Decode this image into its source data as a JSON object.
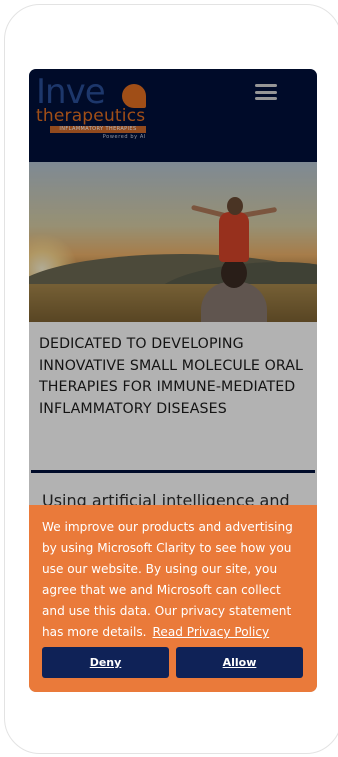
{
  "header": {
    "logo": {
      "word": "Inve",
      "sub": "therapeutics",
      "bar": "INFLAMMATORY THERAPIES",
      "powered": "Powered by AI",
      "colors": {
        "primary": "#2a4f9a",
        "accent": "#e67022"
      }
    },
    "menu_icon": "hamburger-menu-icon",
    "background": "#00103b"
  },
  "hero": {
    "image": "sunset-parent-child-photo"
  },
  "content": {
    "headline": "DEDICATED TO DEVELOPING INNOVATIVE SMALL MOLECULE ORAL THERAPIES FOR IMMUNE-MEDIATED INFLAMMATORY DISEASES",
    "subtext_partial": "Using artificial intelligence and"
  },
  "cookie_banner": {
    "text": "We improve our products and advertising by using Microsoft Clarity to see how you use our website. By using our site, you agree that we and Microsoft can collect and use this data. Our privacy statement has more details.",
    "link": "Read Privacy Policy",
    "deny_label": "Deny",
    "allow_label": "Allow",
    "background": "#ea7a3a",
    "button_color": "#0f2257"
  }
}
